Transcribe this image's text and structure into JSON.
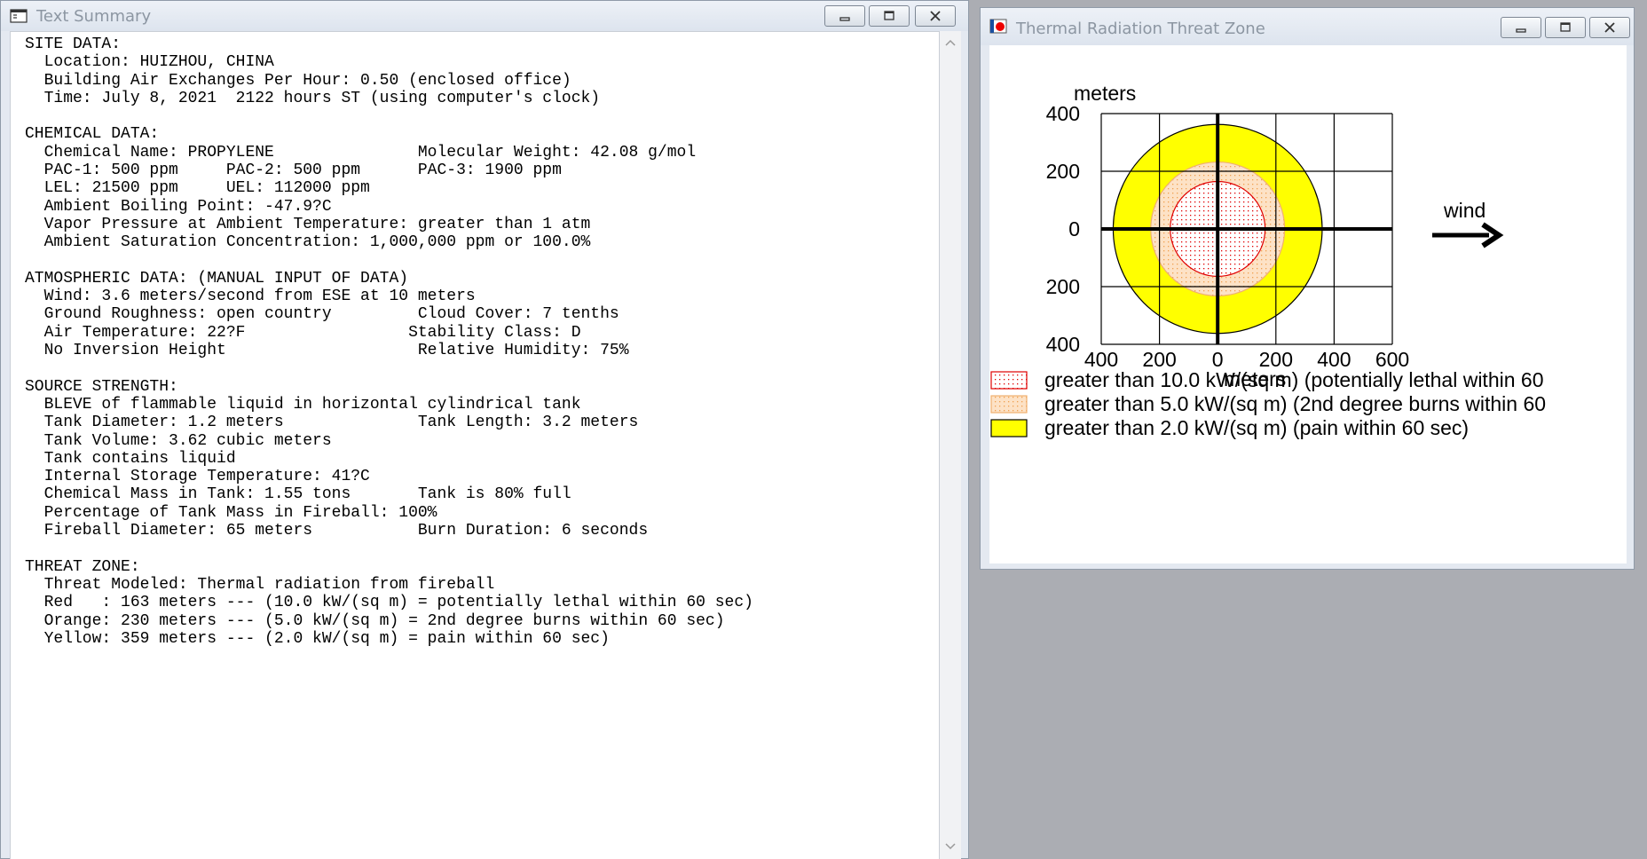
{
  "summary_window": {
    "title": "Text Summary",
    "lines": [
      "SITE DATA:",
      "  Location: HUIZHOU, CHINA",
      "  Building Air Exchanges Per Hour: 0.50 (enclosed office)",
      "  Time: July 8, 2021  2122 hours ST (using computer's clock)",
      "",
      "CHEMICAL DATA:",
      "  Chemical Name: PROPYLENE               Molecular Weight: 42.08 g/mol",
      "  PAC-1: 500 ppm     PAC-2: 500 ppm      PAC-3: 1900 ppm",
      "  LEL: 21500 ppm     UEL: 112000 ppm",
      "  Ambient Boiling Point: -47.9?C",
      "  Vapor Pressure at Ambient Temperature: greater than 1 atm",
      "  Ambient Saturation Concentration: 1,000,000 ppm or 100.0%",
      "",
      "ATMOSPHERIC DATA: (MANUAL INPUT OF DATA)",
      "  Wind: 3.6 meters/second from ESE at 10 meters",
      "  Ground Roughness: open country         Cloud Cover: 7 tenths",
      "  Air Temperature: 22?F                 Stability Class: D",
      "  No Inversion Height                    Relative Humidity: 75%",
      "",
      "SOURCE STRENGTH:",
      "  BLEVE of flammable liquid in horizontal cylindrical tank",
      "  Tank Diameter: 1.2 meters              Tank Length: 3.2 meters",
      "  Tank Volume: 3.62 cubic meters",
      "  Tank contains liquid",
      "  Internal Storage Temperature: 41?C",
      "  Chemical Mass in Tank: 1.55 tons       Tank is 80% full",
      "  Percentage of Tank Mass in Fireball: 100%",
      "  Fireball Diameter: 65 meters           Burn Duration: 6 seconds",
      "",
      "THREAT ZONE:",
      "  Threat Modeled: Thermal radiation from fireball",
      "  Red   : 163 meters --- (10.0 kW/(sq m) = potentially lethal within 60 sec)",
      "  Orange: 230 meters --- (5.0 kW/(sq m) = 2nd degree burns within 60 sec)",
      "  Yellow: 359 meters --- (2.0 kW/(sq m) = pain within 60 sec)"
    ]
  },
  "threat_window": {
    "title": "Thermal Radiation Threat Zone",
    "wind_label": "wind",
    "colors": {
      "red": "#ff0000",
      "orange": "#ffd9b3",
      "yellow": "#ffff00",
      "grid": "#000000"
    },
    "chart_data": {
      "type": "threat-zone-plot",
      "y_unit_label": "meters",
      "x_unit_label": "meters",
      "x_ticks": [
        "400",
        "200",
        "0",
        "200",
        "400",
        "600"
      ],
      "y_ticks": [
        "400",
        "200",
        "0",
        "200",
        "400"
      ],
      "x_range": [
        -400,
        600
      ],
      "y_range": [
        -400,
        400
      ],
      "zones": [
        {
          "name": "Yellow",
          "radius_m": 359,
          "color": "#ffff00"
        },
        {
          "name": "Orange",
          "radius_m": 230,
          "color": "#ffd9b3"
        },
        {
          "name": "Red",
          "radius_m": 163,
          "color": "#ff0000"
        }
      ],
      "legend": [
        {
          "label": "greater than 10.0 kW/(sq m) (potentially lethal within 60",
          "swatch": "red-dotted"
        },
        {
          "label": "greater than 5.0 kW/(sq m) (2nd degree burns within 60",
          "swatch": "orange-dotted"
        },
        {
          "label": "greater than 2.0 kW/(sq m) (pain within 60 sec)",
          "swatch": "yellow"
        }
      ]
    }
  }
}
